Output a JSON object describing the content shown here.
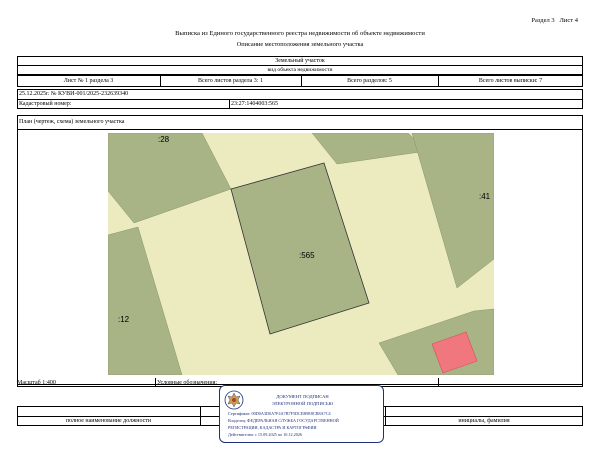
{
  "header": {
    "section_label": "Раздел 3",
    "sheet_label": "Лист 4",
    "title": "Выписка из Единого государственного реестра недвижимости об объекте недвижимости",
    "subtitle": "Описание местоположения земельного участка"
  },
  "object": {
    "type": "Земельный участок",
    "type_caption": "вид объекта недвижимости"
  },
  "sheet_info": {
    "sheet_of_section": "Лист № 1 раздела 3",
    "total_sheets_section": "Всего листов раздела 3: 1",
    "total_sections": "Всего разделов: 5",
    "total_sheets_extract": "Всего листов выписки: 7"
  },
  "document": {
    "date_number": "25.12.2025г. № КУВИ-001/2025-232639340",
    "cadastral_label": "Кадастровый номер:",
    "cadastral_number": "23:27:1404003:565"
  },
  "plan": {
    "title": "План (чертеж, схема) земельного участка",
    "labels": {
      "parcel_28": ":28",
      "parcel_41": ":41",
      "parcel_565": ":565",
      "parcel_12": ":12"
    },
    "colors": {
      "background": "#ecebc0",
      "parcel": "#a8b486",
      "highlight": "#f0777e"
    }
  },
  "footer": {
    "scale": "Масштаб 1:400",
    "legend": "Условные обозначения:",
    "position_caption": "полное наименование должности",
    "name_caption": "инициалы, фамилия"
  },
  "stamp": {
    "title_line1": "ДОКУМЕНТ ПОДПИСАН",
    "title_line2": "ЭЛЕКТРОННОЙ ПОДПИСЬЮ",
    "line_cert": "Сертификат: 00D0A3D0A7F4A7B7F5DCEB9E8CB8A7C4",
    "line_owner1": "Владелец: ФЕДЕРАЛЬНАЯ СЛУЖБА ГОСУДАРСТВЕННОЙ",
    "line_owner2": "РЕГИСТРАЦИИ, КАДАСТРА И КАРТОГРАФИИ",
    "line_valid": "Действителен: с 15.09.2025 по 10.12.2026"
  }
}
